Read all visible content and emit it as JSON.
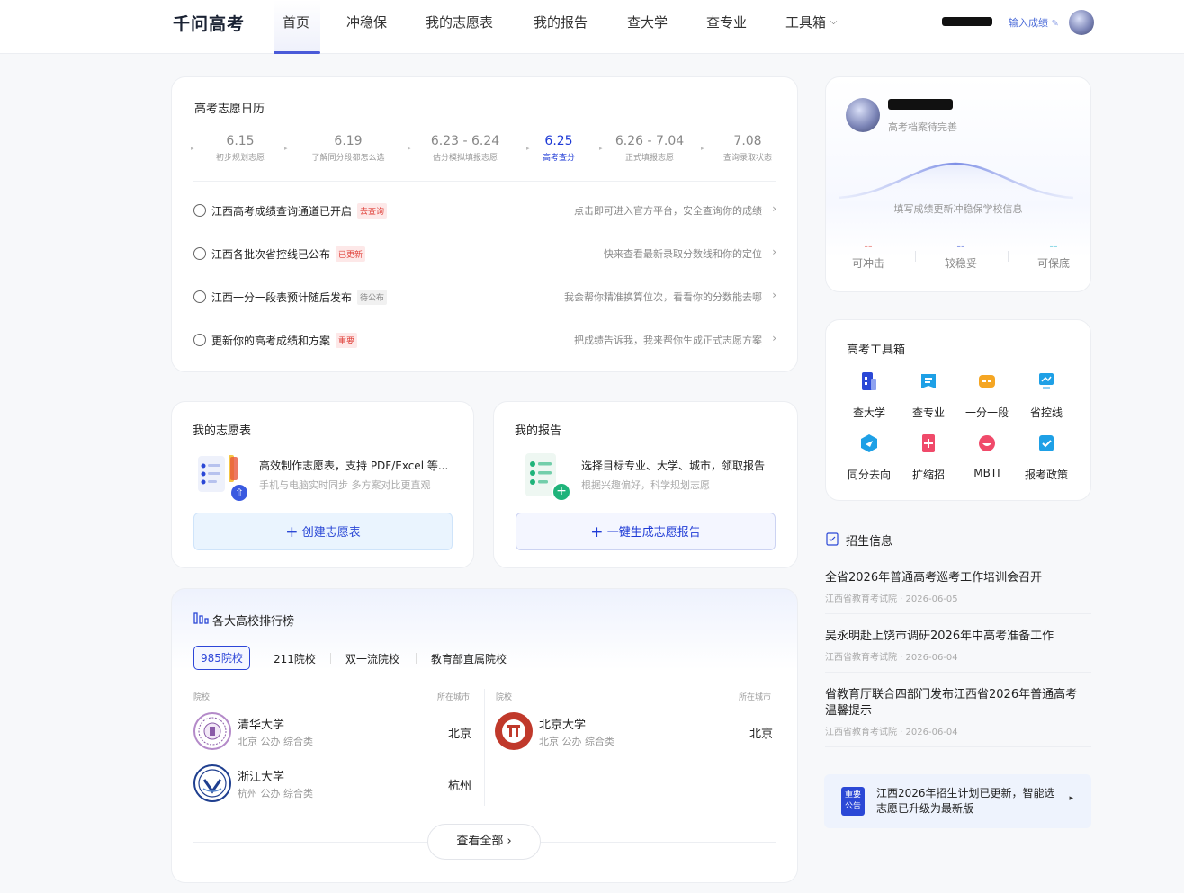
{
  "nav": {
    "logo": "千问高考",
    "items": [
      "首页",
      "冲稳保",
      "我的志愿表",
      "我的报告",
      "查大学",
      "查专业",
      "工具箱"
    ],
    "dropdown_caret": "⌵",
    "input_score": "输入成绩",
    "edit_icon": "✎"
  },
  "calendar": {
    "title": "高考志愿日历",
    "steps": [
      {
        "date": "6.15",
        "sub": "初步规划志愿"
      },
      {
        "date": "6.19",
        "sub": "了解同分段都怎么选"
      },
      {
        "date": "6.23 - 6.24",
        "sub": "估分模拟填报志愿"
      },
      {
        "date": "6.25",
        "sub": "高考查分"
      },
      {
        "date": "6.26 - 7.04",
        "sub": "正式填报志愿"
      },
      {
        "date": "7.08",
        "sub": "查询录取状态"
      }
    ],
    "tasks": [
      {
        "label": "江西高考成绩查询通道已开启",
        "tag": "去查询",
        "right": "点击即可进入官方平台，安全查询你的成绩"
      },
      {
        "label": "江西各批次省控线已公布",
        "tag": "已更新",
        "right": "快来查看最新录取分数线和你的定位"
      },
      {
        "label": "江西一分一段表预计随后发布",
        "tag": "待公布",
        "right": "我会帮你精准换算位次，看看你的分数能去哪"
      },
      {
        "label": "更新你的高考成绩和方案",
        "tag": "重要",
        "right": "把成绩告诉我，我来帮你生成正式志愿方案"
      }
    ],
    "chevron": "›"
  },
  "wishlist": {
    "title": "我的志愿表",
    "main": "高效制作志愿表，支持 PDF/Excel 等...",
    "sub": "手机与电脑实时同步 多方案对比更直观",
    "button": "创建志愿表",
    "plus": "+"
  },
  "report": {
    "title": "我的报告",
    "main": "选择目标专业、大学、城市，领取报告",
    "sub": "根据兴趣偏好，科学规划志愿",
    "button": "一键生成志愿报告",
    "plus": "+"
  },
  "ranking": {
    "title": "各大高校排行榜",
    "tabs": [
      "985院校",
      "211院校",
      "双一流院校",
      "教育部直属院校"
    ],
    "col_school": "院校",
    "col_city": "所在城市",
    "universities": [
      {
        "name": "清华大学",
        "meta": "北京 公办 综合类",
        "city": "北京"
      },
      {
        "name": "北京大学",
        "meta": "北京 公办 综合类",
        "city": "北京"
      },
      {
        "name": "浙江大学",
        "meta": "杭州 公办 综合类",
        "city": "杭州"
      }
    ],
    "view_all": "查看全部 ›"
  },
  "profile": {
    "status": "高考档案待完善",
    "hint": "填写成绩更新冲稳保学校信息",
    "stats": [
      {
        "value": "--",
        "label": "可冲击",
        "color": "#e0413a"
      },
      {
        "value": "--",
        "label": "较稳妥",
        "color": "#2b48d6"
      },
      {
        "value": "--",
        "label": "可保底",
        "color": "#26b7d1"
      }
    ]
  },
  "toolbox": {
    "title": "高考工具箱",
    "tools": [
      {
        "label": "查大学",
        "icon": "university-icon",
        "color": "#2b48d6"
      },
      {
        "label": "查专业",
        "icon": "major-icon",
        "color": "#1ea0e6"
      },
      {
        "label": "一分一段",
        "icon": "score-segment-icon",
        "color": "#f5a623"
      },
      {
        "label": "省控线",
        "icon": "control-line-icon",
        "color": "#1ea0e6"
      },
      {
        "label": "同分去向",
        "icon": "same-score-icon",
        "color": "#1ea0e6"
      },
      {
        "label": "扩缩招",
        "icon": "enrollment-change-icon",
        "color": "#f04a6a"
      },
      {
        "label": "MBTI",
        "icon": "mbti-icon",
        "color": "#f04a6a"
      },
      {
        "label": "报考政策",
        "icon": "policy-icon",
        "color": "#1ea0e6"
      }
    ]
  },
  "news": {
    "title": "招生信息",
    "items": [
      {
        "title": "全省2026年普通高考巡考工作培训会召开",
        "meta": "江西省教育考试院 · 2026-06-05"
      },
      {
        "title": "吴永明赴上饶市调研2026年中高考准备工作",
        "meta": "江西省教育考试院 · 2026-06-04"
      },
      {
        "title": "省教育厅联合四部门发布江西省2026年普通高考温馨提示",
        "meta": "江西省教育考试院 · 2026-06-04"
      }
    ],
    "notice_badge": "重要公告",
    "notice_text": "江西2026年招生计划已更新，智能选志愿已升级为最新版",
    "notice_arrow": "▸"
  }
}
